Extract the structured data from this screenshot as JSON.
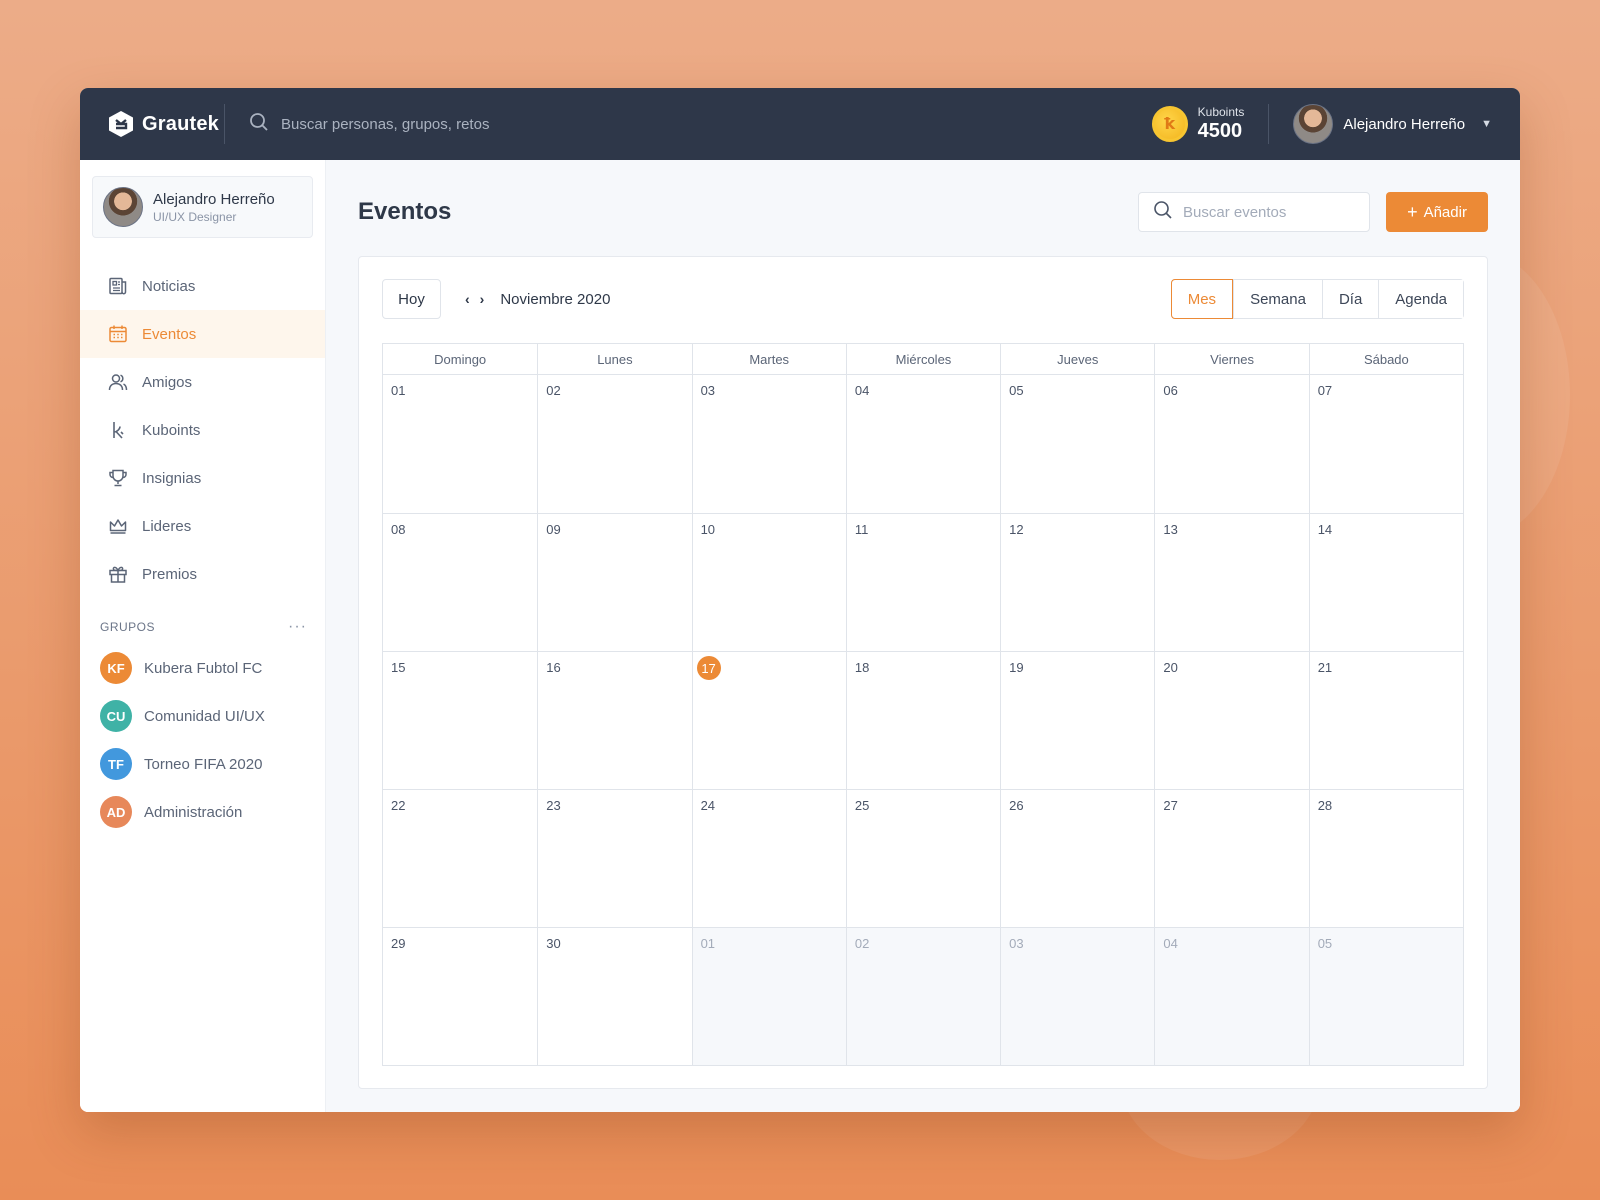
{
  "app": {
    "brand": "Grautek",
    "search_placeholder": "Buscar personas, grupos, retos",
    "kuboints_label": "Kuboints",
    "kuboints_value": "4500",
    "user_name": "Alejandro Herreño"
  },
  "profile": {
    "name": "Alejandro Herreño",
    "role": "UI/UX Designer"
  },
  "nav": [
    {
      "label": "Noticias",
      "icon": "newspaper-icon"
    },
    {
      "label": "Eventos",
      "icon": "calendar-icon",
      "active": true
    },
    {
      "label": "Amigos",
      "icon": "users-icon"
    },
    {
      "label": "Kuboints",
      "icon": "kuboints-icon"
    },
    {
      "label": "Insignias",
      "icon": "trophy-icon"
    },
    {
      "label": "Lideres",
      "icon": "crown-icon"
    },
    {
      "label": "Premios",
      "icon": "gift-icon"
    }
  ],
  "groups_heading": "GRUPOS",
  "groups": [
    {
      "initials": "KF",
      "name": "Kubera Fubtol FC",
      "color": "#ec8a36"
    },
    {
      "initials": "CU",
      "name": "Comunidad UI/UX",
      "color": "#3fb2a6"
    },
    {
      "initials": "TF",
      "name": "Torneo FIFA 2020",
      "color": "#4298dd"
    },
    {
      "initials": "AD",
      "name": "Administración",
      "color": "#e7885a"
    }
  ],
  "main": {
    "title": "Eventos",
    "search_placeholder": "Buscar eventos",
    "add_label": "Añadir"
  },
  "calendar": {
    "today_label": "Hoy",
    "month_label": "Noviembre 2020",
    "views": [
      "Mes",
      "Semana",
      "Día",
      "Agenda"
    ],
    "active_view": "Mes",
    "weekdays": [
      "Domingo",
      "Lunes",
      "Martes",
      "Miércoles",
      "Jueves",
      "Viernes",
      "Sábado"
    ],
    "weeks": [
      [
        "01",
        "02",
        "03",
        "04",
        "05",
        "06",
        "07"
      ],
      [
        "08",
        "09",
        "10",
        "11",
        "12",
        "13",
        "14"
      ],
      [
        "15",
        "16",
        "17",
        "18",
        "19",
        "20",
        "21"
      ],
      [
        "22",
        "23",
        "24",
        "25",
        "26",
        "27",
        "28"
      ],
      [
        "29",
        "30",
        "01",
        "02",
        "03",
        "04",
        "05"
      ]
    ],
    "today": "17",
    "muted_cells_last_week": [
      2,
      3,
      4,
      5,
      6
    ]
  },
  "colors": {
    "accent": "#ec8a36",
    "topbar": "#2e3749"
  }
}
